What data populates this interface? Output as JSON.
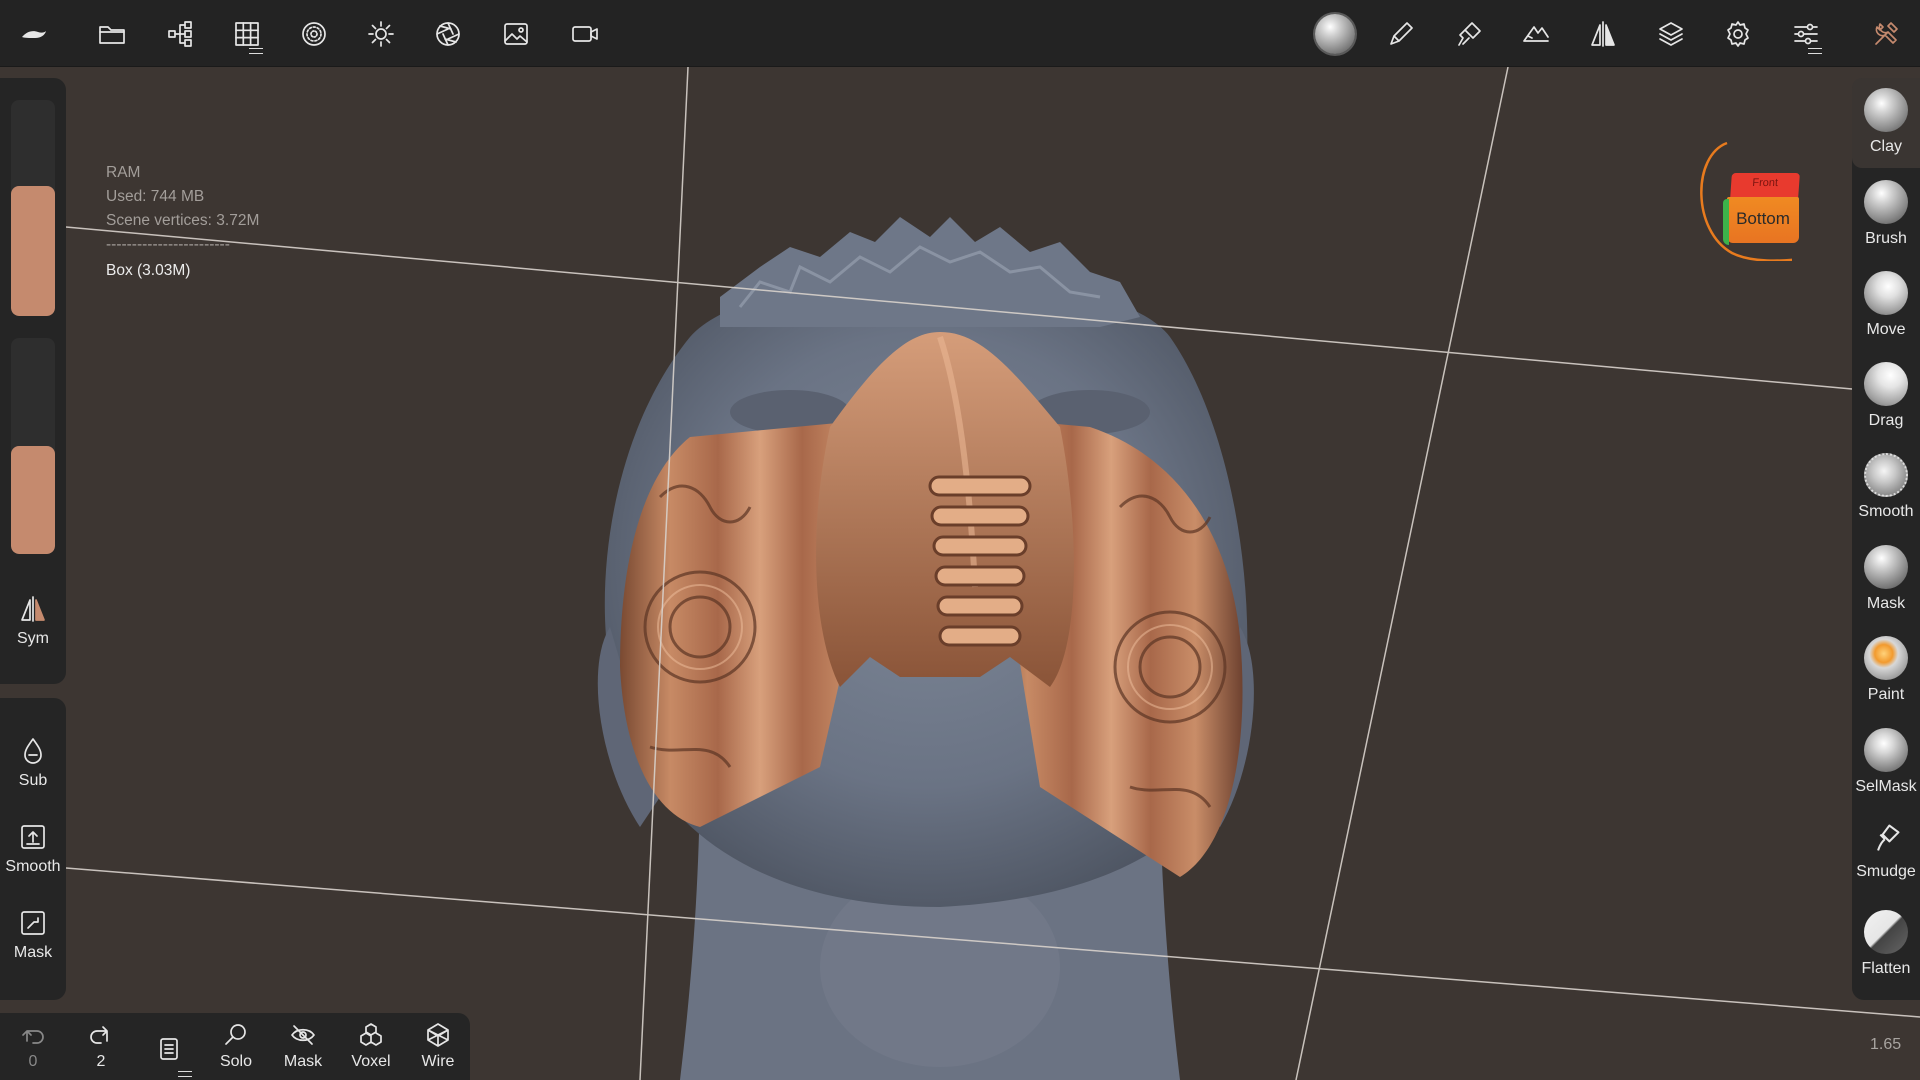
{
  "toolbar_top": {
    "left_icons": [
      "logo-icon",
      "folder-icon",
      "scene-tree-icon",
      "grid-icon",
      "topology-icon",
      "sun-icon",
      "aperture-icon",
      "image-icon",
      "camera-icon"
    ],
    "right_icons": [
      "material-sphere-icon",
      "brush-pen-icon",
      "paint-icon",
      "stroke-icon",
      "symmetry-icon",
      "layers-icon",
      "settings-icon",
      "sliders-icon",
      "tools-icon"
    ]
  },
  "info": {
    "title": "RAM",
    "used": "Used: 744 MB",
    "vertices": "Scene vertices: 3.72M",
    "separator": "------------------------",
    "object": "Box (3.03M)"
  },
  "left_panel": {
    "slider1_level": 0.6,
    "slider2_level": 0.5,
    "sym_label": "Sym"
  },
  "left_actions": {
    "sub_label": "Sub",
    "smooth_label": "Smooth",
    "mask_label": "Mask"
  },
  "right_tools": [
    {
      "label": "Clay",
      "active": true
    },
    {
      "label": "Brush",
      "active": false
    },
    {
      "label": "Move",
      "active": false
    },
    {
      "label": "Drag",
      "active": false
    },
    {
      "label": "Smooth",
      "active": false
    },
    {
      "label": "Mask",
      "active": false
    },
    {
      "label": "Paint",
      "active": false
    },
    {
      "label": "SelMask",
      "active": false
    },
    {
      "label": "Smudge",
      "active": false
    },
    {
      "label": "Flatten",
      "active": false
    }
  ],
  "bottom_bar": {
    "undo_count": "0",
    "redo_count": "2",
    "solo_label": "Solo",
    "mask_label": "Mask",
    "voxel_label": "Voxel",
    "wire_label": "Wire"
  },
  "view_cube": {
    "top_face": "Front",
    "front_face": "Bottom"
  },
  "zoom_value": "1.65",
  "colors": {
    "accent": "#c58a6e",
    "orange": "#e87b1e",
    "background": "#3d3632",
    "panel": "#252525"
  }
}
